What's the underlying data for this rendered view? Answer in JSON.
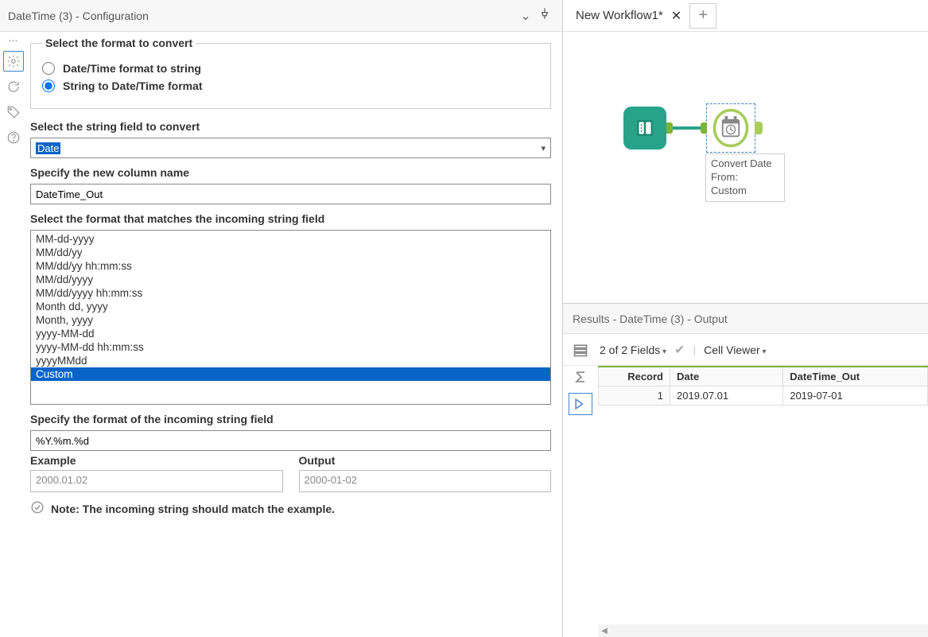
{
  "config": {
    "title": "DateTime (3) - Configuration",
    "group_legend": "Select the format to convert",
    "radio1": "Date/Time format to string",
    "radio2": "String to Date/Time format",
    "label_field": "Select the string field to convert",
    "selected_field": "Date",
    "label_newcol": "Specify the new column name",
    "newcol_value": "DateTime_Out",
    "label_format_list": "Select the format that matches the incoming string field",
    "formats": [
      "MM-dd-yyyy",
      "MM/dd/yy",
      "MM/dd/yy hh:mm:ss",
      "MM/dd/yyyy",
      "MM/dd/yyyy hh:mm:ss",
      "Month dd, yyyy",
      "Month, yyyy",
      "yyyy-MM-dd",
      "yyyy-MM-dd hh:mm:ss",
      "yyyyMMdd",
      "Custom"
    ],
    "selected_format_index": 10,
    "label_custom": "Specify the format of the incoming string field",
    "custom_value": "%Y.%m.%d",
    "example_label": "Example",
    "output_label": "Output",
    "example_value": "2000.01.02",
    "output_value": "2000-01-02",
    "note": "Note: The incoming string should match the example."
  },
  "canvas": {
    "tab_title": "New Workflow1*",
    "node_label": "Convert Date\nFrom:\nCustom"
  },
  "results": {
    "header": "Results - DateTime (3) - Output",
    "fields_summary": "2 of 2 Fields",
    "cell_viewer": "Cell Viewer",
    "columns": [
      "Record",
      "Date",
      "DateTime_Out"
    ],
    "rows": [
      {
        "Record": "1",
        "Date": "2019.07.01",
        "DateTime_Out": "2019-07-01"
      }
    ]
  }
}
